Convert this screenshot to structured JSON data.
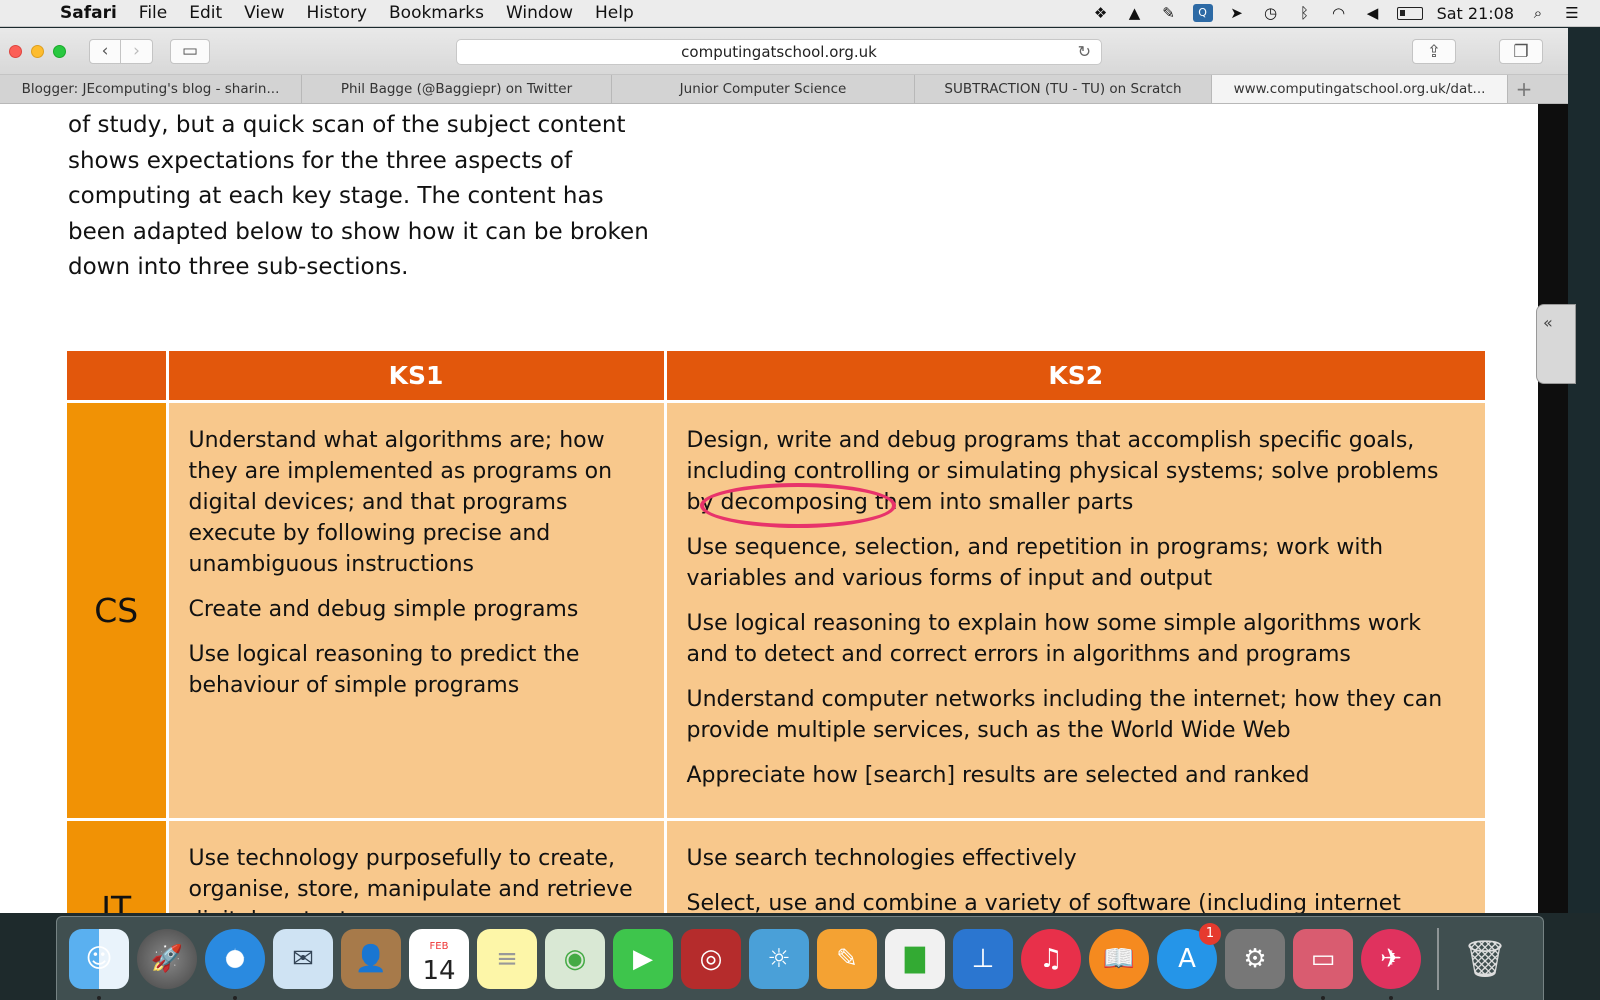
{
  "menubar": {
    "app_name": "Safari",
    "menus": [
      "File",
      "Edit",
      "View",
      "History",
      "Bookmarks",
      "Window",
      "Help"
    ],
    "clock": "Sat 21:08"
  },
  "browser": {
    "url": "computingatschool.org.uk",
    "tabs": [
      "Blogger: JEcomputing's blog - sharin...",
      "Phil Bagge (@Baggiepr) on Twitter",
      "Junior Computer Science",
      "SUBTRACTION (TU - TU) on Scratch",
      "www.computingatschool.org.uk/dat..."
    ],
    "active_tab_index": 4
  },
  "page": {
    "intro_text": "of study, but a quick scan of the subject content shows expectations for the three aspects of computing at each key stage. The content has been adapted below to show how it can be broken down into three sub-sections.",
    "table": {
      "headers": [
        "",
        "KS1",
        "KS2"
      ],
      "rows": [
        {
          "label": "CS",
          "ks1": [
            "Understand what algorithms are; how they are implemented as programs on digital devices; and that programs execute by following precise and unambiguous instructions",
            "Create and debug simple programs",
            "Use logical reasoning to predict the behaviour of simple programs"
          ],
          "ks2_first_before": "Design, write and debug programs that accomplish specific goals, including controlling or simulating physical systems; solve problems by ",
          "ks2_first_highlight": "decomposing",
          "ks2_first_after": " them into smaller parts",
          "ks2": [
            "Use sequence, selection, and repetition in programs; work with variables and various forms of input and output",
            "Use logical reasoning to explain how some simple algorithms work and to detect and correct errors in algorithms and programs",
            "Understand computer networks including the internet; how they can provide multiple services, such as the World Wide Web",
            "Appreciate how [search] results are selected and ranked"
          ]
        },
        {
          "label": "IT",
          "ks1": [
            "Use technology purposefully to create, organise, store, manipulate and retrieve digital content"
          ],
          "ks2": [
            "Use search technologies effectively",
            "Select, use and combine a variety of software (including internet"
          ]
        }
      ]
    }
  },
  "dock": {
    "calendar_month": "FEB",
    "calendar_day": "14",
    "app_store_badge": "1",
    "items": [
      "finder-icon",
      "launchpad-icon",
      "safari-icon",
      "mail-icon",
      "contacts-icon",
      "calendar-icon",
      "notes-icon",
      "preview-icon",
      "facetime-icon",
      "photo-booth-icon",
      "iphoto-icon",
      "pages-icon",
      "numbers-icon",
      "keynote-icon",
      "itunes-icon",
      "ibooks-icon",
      "app-store-icon",
      "system-preferences-icon",
      "display-icon",
      "skitch-icon",
      "trash-icon"
    ]
  }
}
